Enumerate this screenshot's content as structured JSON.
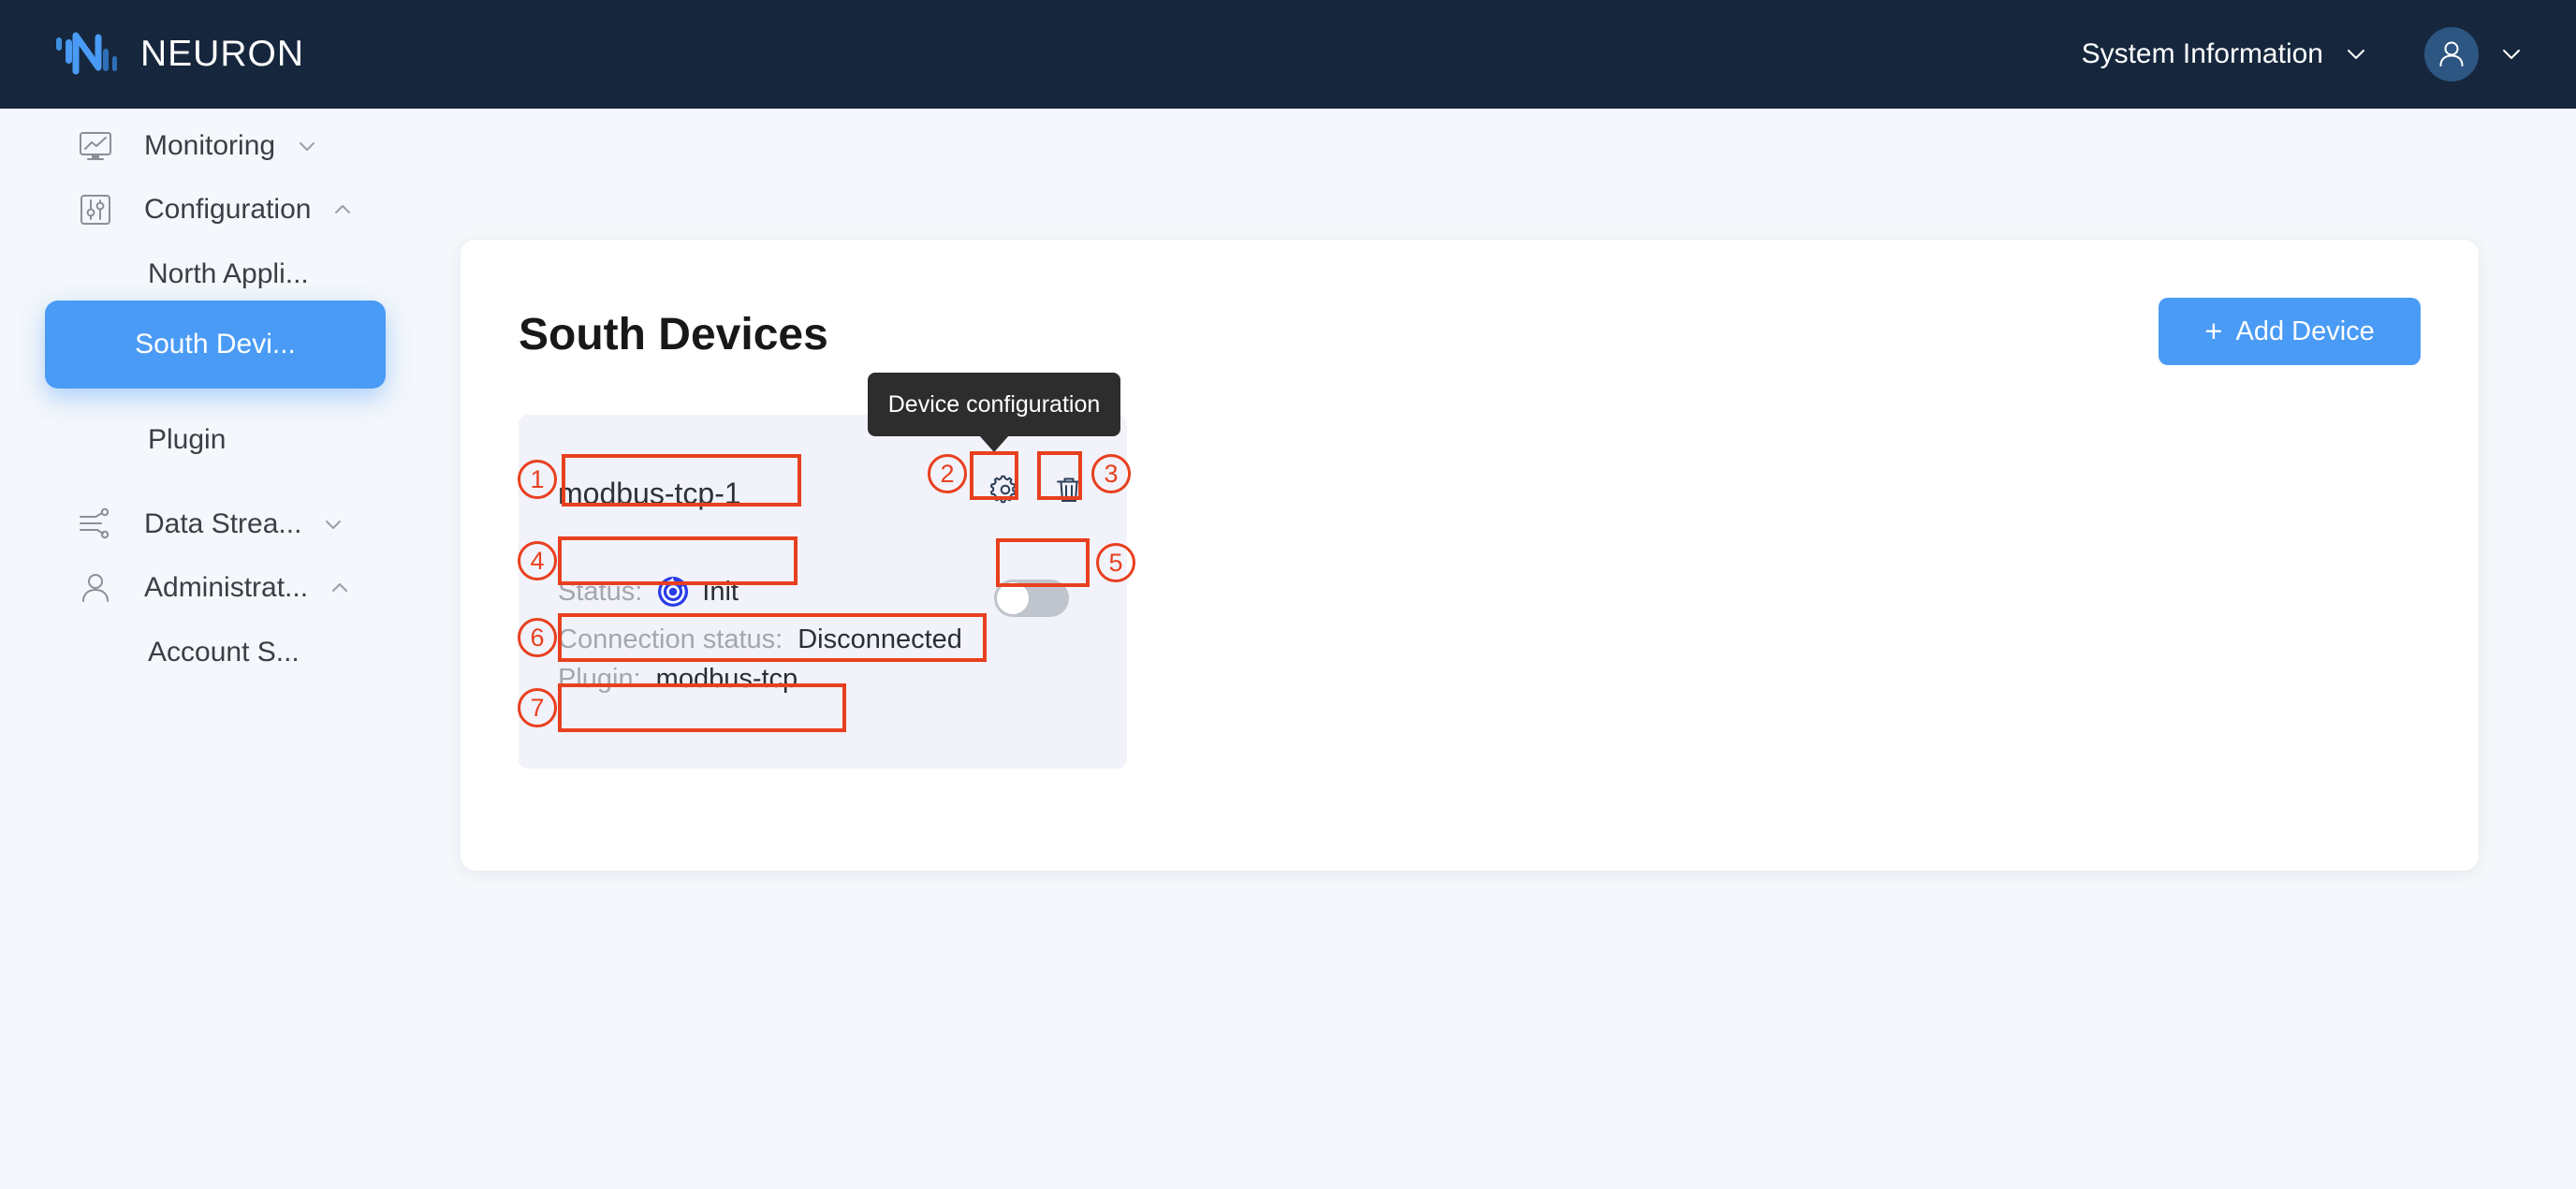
{
  "header": {
    "brand": "NEURON",
    "brand_logo_icon": "neuron-waveform-logo",
    "system_information_label": "System Information",
    "system_information_caret_icon": "chevron-down-icon",
    "avatar_icon": "user-avatar-icon",
    "avatar_caret_icon": "chevron-down-icon",
    "background_color": "#16273d"
  },
  "sidebar": {
    "items": [
      {
        "label": "Monitoring",
        "icon": "monitor-chart-icon",
        "caret": "chevron-down-icon",
        "expanded": false,
        "active": false
      },
      {
        "label": "Configuration",
        "icon": "sliders-icon",
        "caret": "chevron-up-icon",
        "expanded": true,
        "active": false
      },
      {
        "label": "North Appli...",
        "icon": "none",
        "caret": "none",
        "child": true,
        "active": false
      },
      {
        "label": "South Devi...",
        "icon": "none",
        "caret": "none",
        "child": true,
        "active": true
      },
      {
        "label": "Plugin",
        "icon": "none",
        "caret": "none",
        "child": true,
        "active": false
      },
      {
        "label": "Data Strea...",
        "icon": "data-stream-icon",
        "caret": "chevron-down-icon",
        "expanded": false,
        "active": false
      },
      {
        "label": "Administrat...",
        "icon": "user-icon",
        "caret": "chevron-up-icon",
        "expanded": true,
        "active": false
      },
      {
        "label": "Account S...",
        "icon": "none",
        "caret": "none",
        "child": true,
        "active": false
      }
    ],
    "active_color": "#4a9bf5"
  },
  "main": {
    "page_title": "South Devices",
    "add_device_label": "Add Device",
    "add_device_plus": "+",
    "add_device_color": "#4a9bf5"
  },
  "device": {
    "name": "modbus-tcp-1",
    "config_icon": "gear-icon",
    "delete_icon": "trash-icon",
    "status_key": "Status:",
    "status_value": "Init",
    "status_icon": "refresh-spinner-icon",
    "status_icon_color": "#2a3de8",
    "connection_key": "Connection status:",
    "connection_value": "Disconnected",
    "plugin_key": "Plugin:",
    "plugin_value": "modbus-tcp",
    "toggle_on": false,
    "toggle_off_color": "#c0c4cc",
    "tile_background": "#f2f2fa"
  },
  "tooltip": {
    "text": "Device configuration",
    "background_color": "#2d2d2d"
  },
  "annotations": {
    "color": "#e8401f",
    "markers": [
      {
        "number": "1",
        "target": "device-name"
      },
      {
        "number": "2",
        "target": "device-config-gear-button"
      },
      {
        "number": "3",
        "target": "device-delete-button"
      },
      {
        "number": "4",
        "target": "device-status-row"
      },
      {
        "number": "5",
        "target": "device-enable-toggle"
      },
      {
        "number": "6",
        "target": "device-connection-status-row"
      },
      {
        "number": "7",
        "target": "device-plugin-row"
      }
    ]
  }
}
